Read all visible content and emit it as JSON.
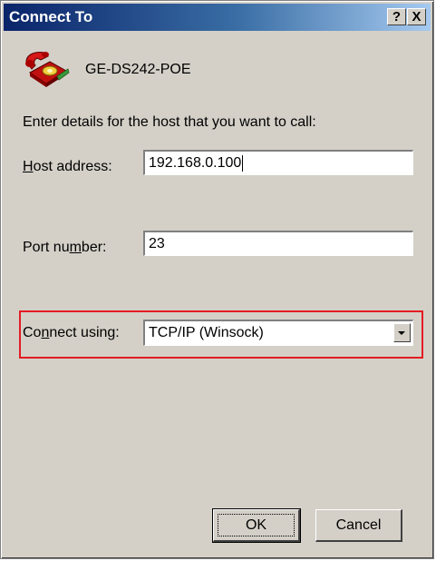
{
  "window": {
    "title": "Connect To",
    "help_glyph": "?",
    "close_glyph": "X"
  },
  "connection": {
    "name": "GE-DS242-POE",
    "icon": "red-telephone-icon"
  },
  "instructions": "Enter details for the host that you want to call:",
  "host": {
    "label_accel": "H",
    "label_rest": "ost address:",
    "value": "192.168.0.100"
  },
  "port": {
    "label_pre": "Port nu",
    "label_accel": "m",
    "label_post": "ber:",
    "value": "23"
  },
  "connect_using": {
    "label_pre": "Co",
    "label_accel": "n",
    "label_post": "nect using:",
    "selected": "TCP/IP (Winsock)"
  },
  "buttons": {
    "ok": "OK",
    "cancel": "Cancel"
  },
  "colors": {
    "highlight_border": "#e31b23",
    "titlebar_start": "#0a246a",
    "titlebar_end": "#a6caf0",
    "dialog_face": "#d4d0c8"
  }
}
